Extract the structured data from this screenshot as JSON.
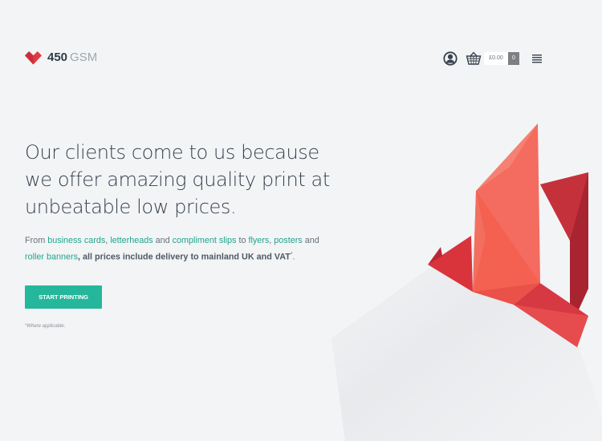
{
  "brand": {
    "number": "450",
    "name": "GSM",
    "colors": {
      "red": "#e03b42",
      "teal": "#24b79b",
      "link": "#20a58b",
      "text": "#36414c",
      "background": "#f3f4f6"
    }
  },
  "header": {
    "account_icon": "user-icon",
    "basket_icon": "basket-icon",
    "cart_total": "£0.00",
    "cart_count": "0",
    "menu_icon": "hamburger-menu-icon"
  },
  "hero": {
    "headline": "Our clients come to us because we offer amazing quality print at unbeatable low prices.",
    "copy": {
      "from": "From",
      "business_cards": "business cards",
      "comma_1": ",",
      "letterheads": "letterheads",
      "and_1": "and",
      "compliment_slips": "compliment slips",
      "to": "to",
      "flyers": "flyers",
      "comma_2": ",",
      "posters": "posters",
      "and_2": "and",
      "roller_banners": "roller banners",
      "delivery": ", all prices include delivery to mainland UK and VAT",
      "asterisk": "*",
      "period": "."
    },
    "button": "START PRINTING",
    "note": "*Where applicable."
  },
  "illustration": {
    "name": "origami-bird"
  }
}
